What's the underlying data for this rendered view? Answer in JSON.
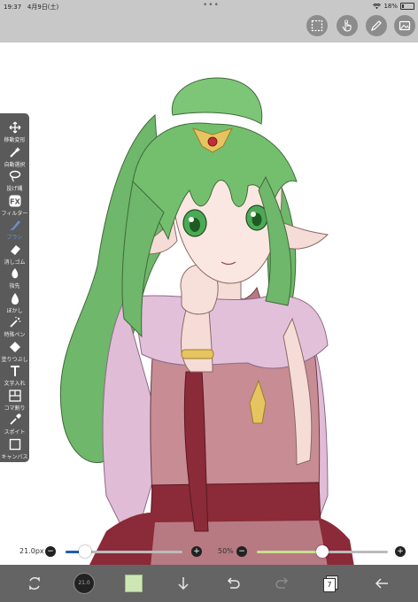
{
  "status_bar": {
    "time": "19:37",
    "date": "4月9日(土)",
    "battery": "18%"
  },
  "top_toolbar": {
    "icons": [
      "selection-icon",
      "gesture-hand-icon",
      "pen-pressure-icon",
      "layer-image-icon"
    ]
  },
  "toolbox": {
    "tools": [
      {
        "label": "移動変形",
        "icon": "move-icon",
        "selected": false
      },
      {
        "label": "自動選択",
        "icon": "magic-wand-icon",
        "selected": false
      },
      {
        "label": "投げ縄",
        "icon": "lasso-icon",
        "selected": false
      },
      {
        "label": "フィルター",
        "icon": "fx-icon",
        "selected": false
      },
      {
        "label": "ブラシ",
        "icon": "brush-icon",
        "selected": true
      },
      {
        "label": "消しゴム",
        "icon": "eraser-icon",
        "selected": false
      },
      {
        "label": "指先",
        "icon": "smudge-icon",
        "selected": false
      },
      {
        "label": "ぼかし",
        "icon": "blur-icon",
        "selected": false
      },
      {
        "label": "特殊ペン",
        "icon": "special-pen-icon",
        "selected": false
      },
      {
        "label": "塗りつぶし",
        "icon": "fill-icon",
        "selected": false
      },
      {
        "label": "文字入れ",
        "icon": "text-icon",
        "selected": false
      },
      {
        "label": "コマ割り",
        "icon": "frame-divider-icon",
        "selected": false
      },
      {
        "label": "スポイト",
        "icon": "eyedropper-icon",
        "selected": false
      },
      {
        "label": "キャンバス",
        "icon": "canvas-icon",
        "selected": false
      }
    ]
  },
  "brush_size": {
    "value_text": "21.0px",
    "minus": "−",
    "plus": "+",
    "level": 0.17
  },
  "opacity": {
    "value_text": "50%",
    "minus": "−",
    "plus": "+",
    "level": 0.5
  },
  "bottom_toolbar": {
    "layer_count": "7",
    "brush_preview_text": "21.0"
  },
  "colors": {
    "accent": "#1f5fa8",
    "opacity_fill": "#c4df8f",
    "current_color": "#cde7b4"
  }
}
